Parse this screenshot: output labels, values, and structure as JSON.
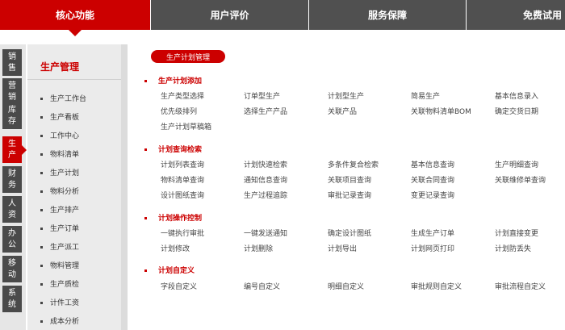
{
  "top_tabs": [
    "核心功能",
    "用户评价",
    "服务保障",
    "免费试用"
  ],
  "categories": [
    "销售",
    "营销",
    "库存",
    "生产",
    "财务",
    "人资",
    "办公",
    "移动",
    "系统"
  ],
  "submenu": {
    "title": "生产管理",
    "items": [
      "生产工作台",
      "生产看板",
      "工作中心",
      "物料清单",
      "生产计划",
      "物料分析",
      "生产排产",
      "生产订单",
      "生产派工",
      "物料管理",
      "生产质检",
      "计件工资",
      "成本分析"
    ]
  },
  "content": {
    "pill": "生产计划管理",
    "sections": [
      {
        "title": "生产计划添加",
        "rows": [
          [
            "生产类型选择",
            "订单型生产",
            "计划型生产",
            "简易生产",
            "基本信息录入"
          ],
          [
            "优先级排列",
            "选择生产产品",
            "关联产品",
            "关联物料清单BOM",
            "确定交货日期"
          ],
          [
            "生产计划草稿箱"
          ]
        ]
      },
      {
        "title": "计划查询检索",
        "rows": [
          [
            "计划列表查询",
            "计划快速检索",
            "多条件复合检索",
            "基本信息查询",
            "生产明细查询"
          ],
          [
            "物料清单查询",
            "通知信息查询",
            "关联项目查询",
            "关联合同查询",
            "关联维修单查询"
          ],
          [
            "设计图纸查询",
            "生产过程追踪",
            "审批记录查询",
            "变更记录查询"
          ]
        ]
      },
      {
        "title": "计划操作控制",
        "rows": [
          [
            "一键执行审批",
            "一键发送通知",
            "确定设计图纸",
            "生成生产订单",
            "计划直接变更"
          ],
          [
            "计划修改",
            "计划删除",
            "计划导出",
            "计划网页打印",
            "计划防丢失"
          ]
        ]
      },
      {
        "title": "计划自定义",
        "rows": [
          [
            "字段自定义",
            "编号自定义",
            "明细自定义",
            "审批规则自定义",
            "审批流程自定义"
          ]
        ]
      }
    ]
  }
}
